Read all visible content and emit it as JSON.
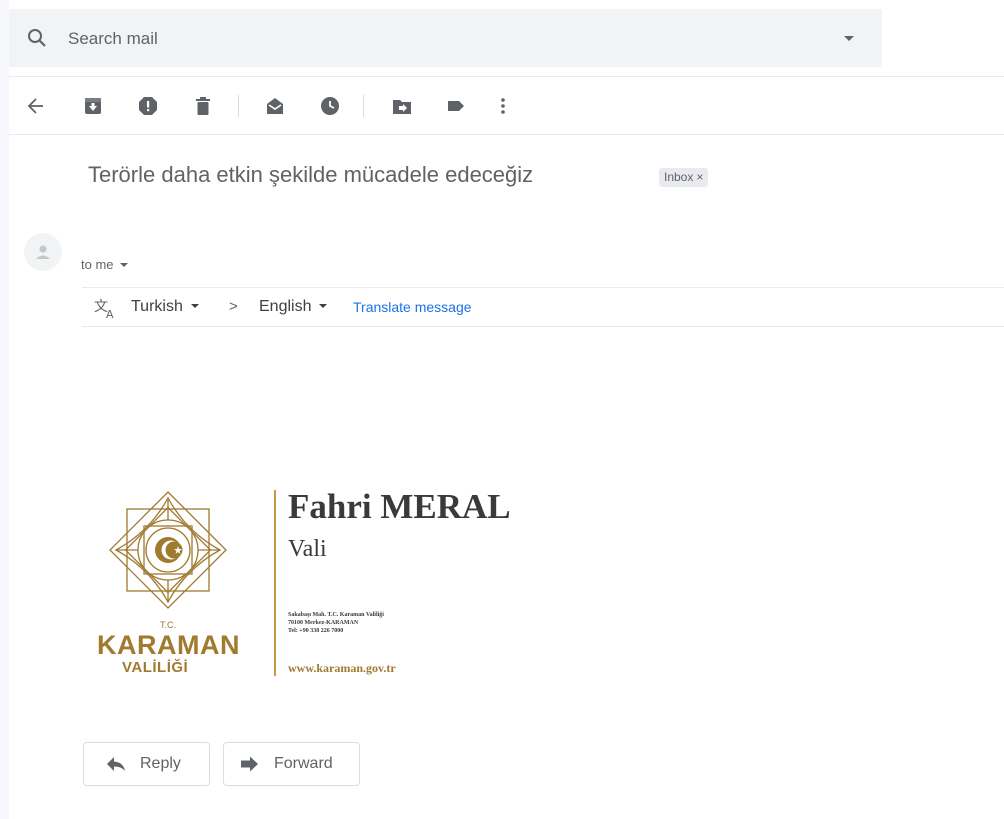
{
  "search": {
    "placeholder": "Search mail"
  },
  "toolbar": {
    "icons": [
      "back-arrow-icon",
      "archive-icon",
      "report-spam-icon",
      "delete-icon",
      "mark-unread-icon",
      "snooze-icon",
      "move-to-icon",
      "label-icon",
      "more-vert-icon"
    ]
  },
  "email": {
    "subject": "Terörle daha etkin şekilde mücadele edeceğiz",
    "label_chip": "Inbox",
    "label_chip_close": "×",
    "recipient": "to me"
  },
  "translate": {
    "from_language": "Turkish",
    "arrow": ">",
    "to_language": "English",
    "action": "Translate message"
  },
  "signature": {
    "tc": "T.C.",
    "org": "KARAMAN",
    "org_sub": "VALİLİĞİ",
    "name": "Fahri MERAL",
    "title": "Vali",
    "address_line1": "Sakabaşı Mah. T.C. Karaman Valiliği",
    "address_line2": "70100 Merkez-KARAMAN",
    "address_line3": "Tel: +90 338 226 7000",
    "website": "www.karaman.gov.tr"
  },
  "actions": {
    "reply": "Reply",
    "forward": "Forward"
  },
  "colors": {
    "accent_gold": "#a07a2f",
    "link_blue": "#1a73e8",
    "icon_gray": "#5f6368"
  }
}
